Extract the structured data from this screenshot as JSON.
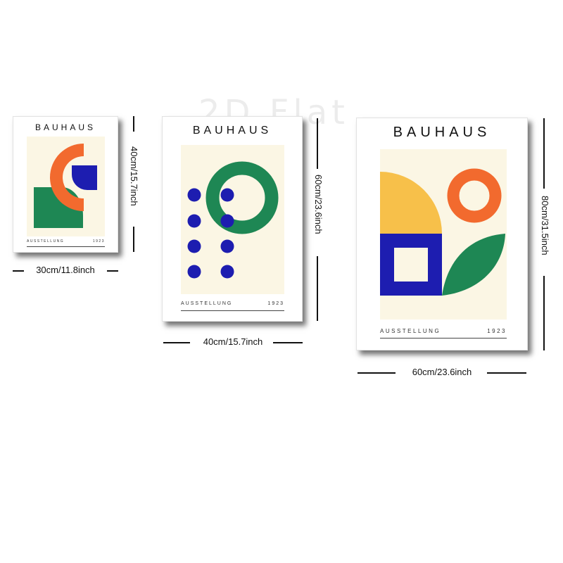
{
  "watermark": "2D Flat",
  "colors": {
    "orange": "#F26A2E",
    "blue": "#1D1DB0",
    "green": "#1E8754",
    "yellow": "#F7C04A",
    "cream": "#FBF6E4"
  },
  "posters": [
    {
      "title": "BAUHAUS",
      "footer_left": "AUSSTELLUNG",
      "footer_right": "1923",
      "width_label": "30cm/11.8inch",
      "height_label": "40cm/15.7inch",
      "artwork": "half-ring-square-quarter-circle"
    },
    {
      "title": "BAUHAUS",
      "footer_left": "AUSSTELLUNG",
      "footer_right": "1923",
      "width_label": "40cm/15.7inch",
      "height_label": "60cm/23.6inch",
      "artwork": "dots-and-ring"
    },
    {
      "title": "BAUHAUS",
      "footer_left": "AUSSTELLUNG",
      "footer_right": "1923",
      "width_label": "60cm/23.6inch",
      "height_label": "80cm/31.5inch",
      "artwork": "semicircle-ring-square-leaf"
    }
  ]
}
